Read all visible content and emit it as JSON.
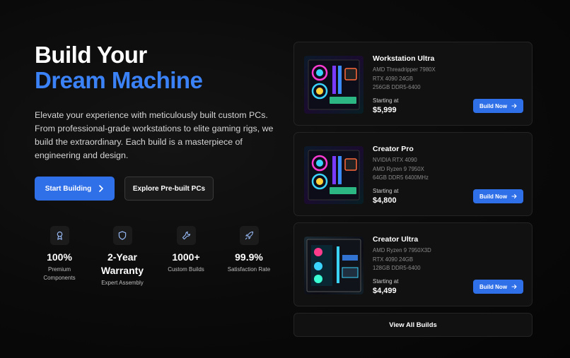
{
  "hero": {
    "title_line1": "Build Your",
    "title_line2": "Dream Machine",
    "description": "Elevate your experience with meticulously built custom PCs. From professional-grade workstations to elite gaming rigs, we build the extraordinary. Each build is a masterpiece of engineering and design.",
    "primary_button": "Start Building",
    "secondary_button": "Explore Pre-built PCs"
  },
  "stats": [
    {
      "icon": "award-icon",
      "value": "100%",
      "label": "Premium Components"
    },
    {
      "icon": "shield-icon",
      "value": "2-Year Warranty",
      "label": "Expert Assembly"
    },
    {
      "icon": "wrench-icon",
      "value": "1000+",
      "label": "Custom Builds"
    },
    {
      "icon": "rocket-icon",
      "value": "99.9%",
      "label": "Satisfaction Rate"
    }
  ],
  "builds": [
    {
      "name": "Workstation Ultra",
      "specs": [
        "AMD Threadripper 7980X",
        "RTX 4090 24GB",
        "256GB DDR5-6400"
      ],
      "starting_label": "Starting at",
      "price": "$5,999",
      "button": "Build Now"
    },
    {
      "name": "Creator Pro",
      "specs": [
        "NVIDIA RTX 4090",
        "AMD Ryzen 9 7950X",
        "64GB DDR5 6400MHz"
      ],
      "starting_label": "Starting at",
      "price": "$4,800",
      "button": "Build Now"
    },
    {
      "name": "Creator Ultra",
      "specs": [
        "AMD Ryzen 9 7950X3D",
        "RTX 4090 24GB",
        "128GB DDR5-6400"
      ],
      "starting_label": "Starting at",
      "price": "$4,499",
      "button": "Build Now"
    }
  ],
  "view_all": "View All Builds",
  "colors": {
    "accent": "#3b82f6",
    "button": "#2f6fe8",
    "card": "#111111"
  }
}
